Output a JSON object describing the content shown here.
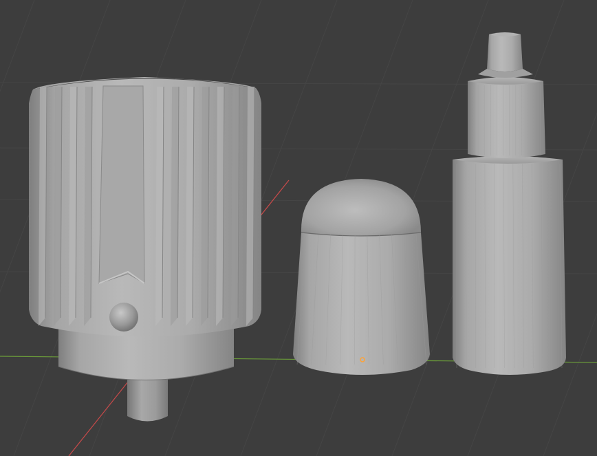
{
  "viewport": {
    "background": "#3d3d3d",
    "grid_color": "#454545",
    "x_axis_color": "#c94a4a",
    "y_axis_color": "#6a9a3a",
    "origin_color": "#ffa235"
  },
  "objects": [
    {
      "name": "drill-chuck",
      "type": "mesh"
    },
    {
      "name": "dome-cap",
      "type": "mesh"
    },
    {
      "name": "stepped-bottle",
      "type": "mesh"
    }
  ]
}
